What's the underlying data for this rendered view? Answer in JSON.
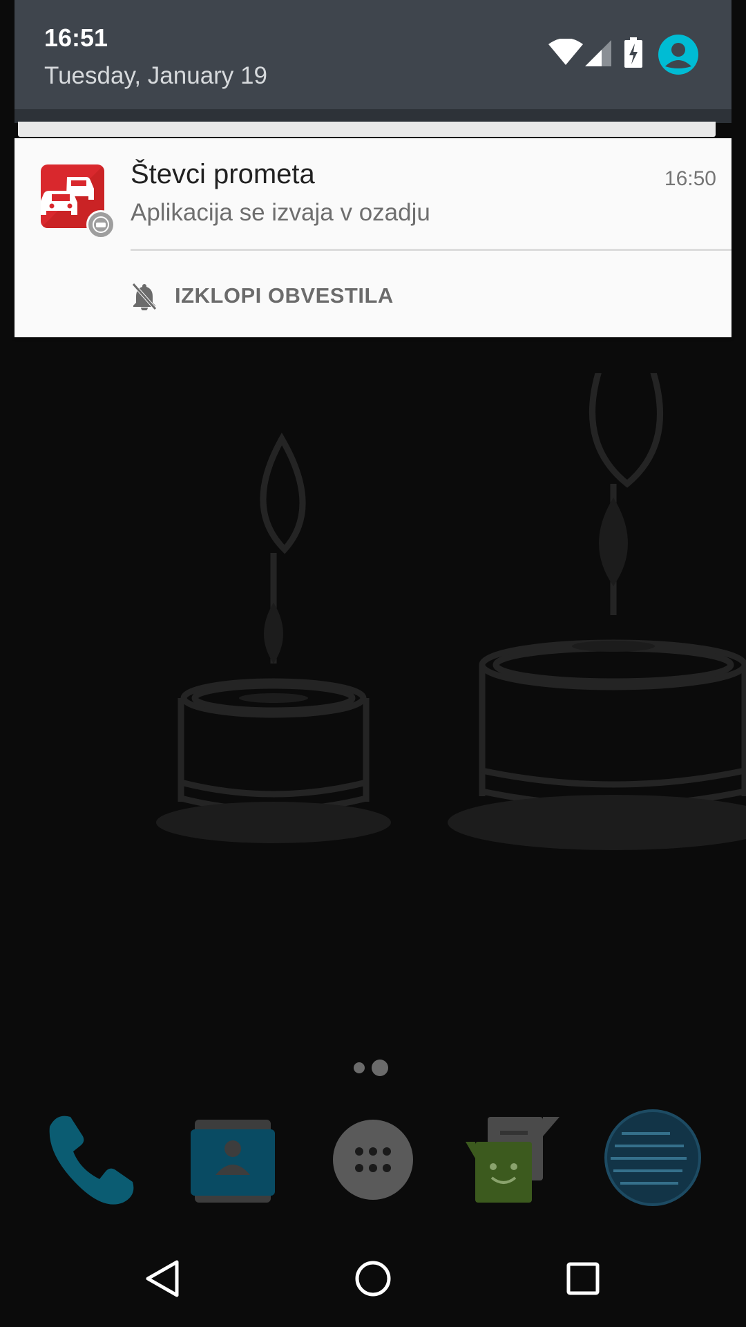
{
  "status": {
    "time": "16:51",
    "date": "Tuesday, January 19"
  },
  "notification": {
    "app_title": "Števci prometa",
    "time": "16:50",
    "text": "Aplikacija se izvaja v ozadju",
    "action_label": "IZKLOPI OBVESTILA",
    "accent_color": "#d9282d"
  },
  "dock": {
    "items": [
      "phone-icon",
      "contacts-icon",
      "app-drawer-icon",
      "messenger-icon",
      "browser-icon"
    ]
  },
  "page_indicator": {
    "count": 2,
    "active_index": 1
  },
  "nav": {
    "items": [
      "back-icon",
      "home-icon",
      "recents-icon"
    ]
  }
}
